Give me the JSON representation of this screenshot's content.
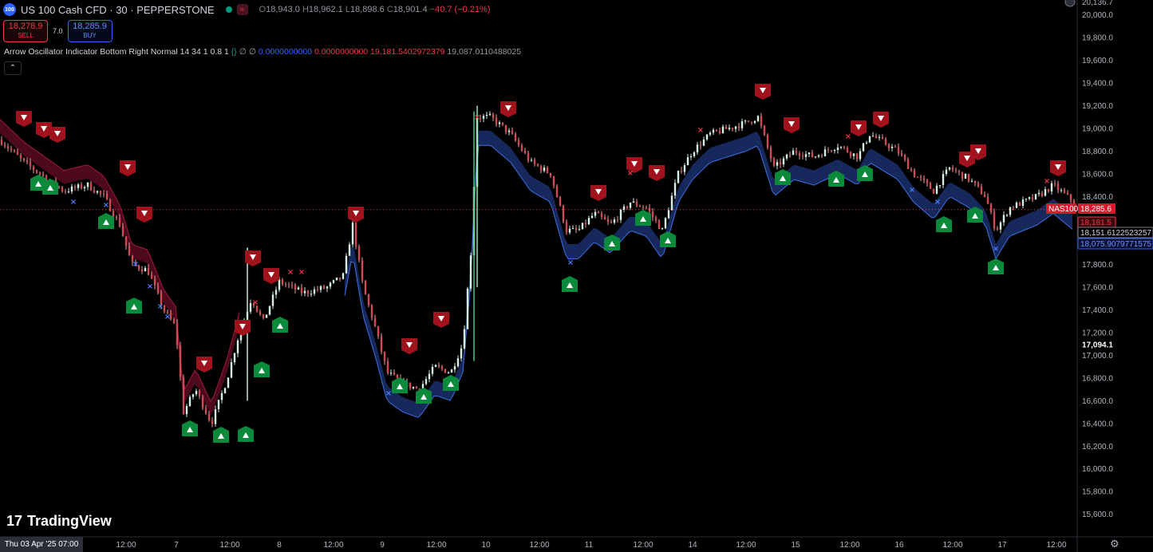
{
  "header": {
    "logo_text": "100",
    "symbol_title": "US 100 Cash CFD · 30 · PEPPERSTONE",
    "ohlc": {
      "o_label": "O",
      "o": "18,943.0",
      "h_label": "H",
      "h": "18,962.1",
      "l_label": "L",
      "l": "18,898.6",
      "c_label": "C",
      "c": "18,901.4",
      "change": "−40.7 (−0.21%)"
    }
  },
  "trade": {
    "sell_price": "18,278.9",
    "sell_label": "SELL",
    "spread": "7.0",
    "buy_price": "18,285.9",
    "buy_label": "BUY"
  },
  "indicator": {
    "name": "Arrow Oscillator Indicator Bottom Right Normal 14 34 1 0.8 1",
    "braces": "{}",
    "v1": "∅",
    "v2": "∅",
    "v3": "0.0000000000",
    "v4": "0.0000000000",
    "v5": "19,181.5402972379",
    "v6": "19,087.0110488025"
  },
  "branding": {
    "name": "TradingView"
  },
  "crosshair_date": "Thu 03 Apr '25   07:00",
  "price_axis": {
    "top_partial": "20,136.7",
    "ticks": [
      {
        "label": "20,000.0",
        "value": 20000
      },
      {
        "label": "19,800.0",
        "value": 19800
      },
      {
        "label": "19,600.0",
        "value": 19600
      },
      {
        "label": "19,400.0",
        "value": 19400
      },
      {
        "label": "19,200.0",
        "value": 19200
      },
      {
        "label": "19,000.0",
        "value": 19000
      },
      {
        "label": "18,800.0",
        "value": 18800
      },
      {
        "label": "18,600.0",
        "value": 18600
      },
      {
        "label": "18,400.0",
        "value": 18400
      },
      {
        "label": "17,800.0",
        "value": 17800
      },
      {
        "label": "17,600.0",
        "value": 17600
      },
      {
        "label": "17,400.0",
        "value": 17400
      },
      {
        "label": "17,200.0",
        "value": 17200
      },
      {
        "label": "17,000.0",
        "value": 17000
      },
      {
        "label": "16,800.0",
        "value": 16800
      },
      {
        "label": "16,600.0",
        "value": 16600
      },
      {
        "label": "16,400.0",
        "value": 16400
      },
      {
        "label": "16,200.0",
        "value": 16200
      },
      {
        "label": "16,000.0",
        "value": 16000
      },
      {
        "label": "15,800.0",
        "value": 15800
      },
      {
        "label": "15,600.0",
        "value": 15600
      }
    ],
    "highlight": {
      "label": "17,094.1",
      "value": 17094.1
    },
    "badges": {
      "symbol": "NAS100",
      "last_price": "18,285.6",
      "last_value": 18285.6,
      "bid": "18,181.5",
      "upper_band": "18,151.6122523257",
      "lower_band": "18,075.9079771575"
    }
  },
  "time_axis": [
    "12:00",
    "7",
    "12:00",
    "8",
    "12:00",
    "9",
    "12:00",
    "10",
    "12:00",
    "11",
    "12:00",
    "14",
    "12:00",
    "15",
    "12:00",
    "16",
    "12:00",
    "17",
    "12:00"
  ],
  "colors": {
    "up": "#089981",
    "down": "#f23645",
    "signal_up": "#0a8a3a",
    "signal_down": "#a0121c",
    "band_red": "#5a0c22",
    "band_blue": "#1a2c66"
  }
}
